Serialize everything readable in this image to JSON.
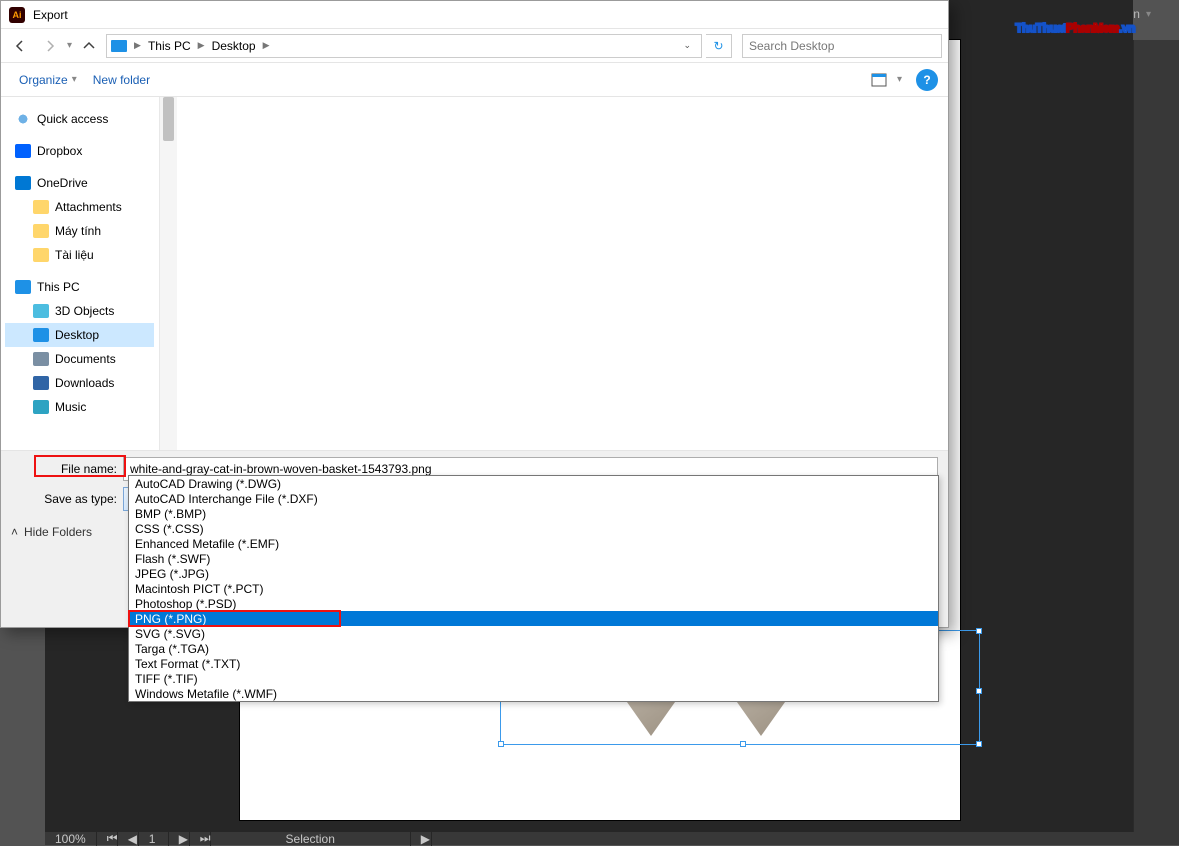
{
  "ai": {
    "menu_automation": "Automation",
    "status": {
      "zoom": "100%",
      "center": "Selection"
    }
  },
  "watermark": {
    "part1": "ThuThuat",
    "part2": "PhanMem",
    "part3": ".vn"
  },
  "dialog": {
    "title": "Export",
    "nav": {
      "pc": "This PC",
      "desktop": "Desktop"
    },
    "refresh_icon": "↻",
    "search_placeholder": "Search Desktop",
    "toolbar": {
      "organize": "Organize",
      "newfolder": "New folder"
    },
    "tree": {
      "quick": "Quick access",
      "dropbox": "Dropbox",
      "onedrive": "OneDrive",
      "attachments": "Attachments",
      "maytinh": "Máy tính",
      "tailieu": "Tài liệu",
      "thispc": "This PC",
      "objects3d": "3D Objects",
      "desktop": "Desktop",
      "documents": "Documents",
      "downloads": "Downloads",
      "music": "Music"
    },
    "fields": {
      "fname_label": "File name:",
      "fname_value": "white-and-gray-cat-in-brown-woven-basket-1543793.png",
      "type_label": "Save as type:",
      "type_value": "PNG (*.PNG)"
    },
    "hide_folders": "Hide Folders",
    "type_options": [
      "AutoCAD Drawing (*.DWG)",
      "AutoCAD Interchange File (*.DXF)",
      "BMP (*.BMP)",
      "CSS (*.CSS)",
      "Enhanced Metafile (*.EMF)",
      "Flash (*.SWF)",
      "JPEG (*.JPG)",
      "Macintosh PICT (*.PCT)",
      "Photoshop (*.PSD)",
      "PNG (*.PNG)",
      "SVG (*.SVG)",
      "Targa (*.TGA)",
      "Text Format (*.TXT)",
      "TIFF (*.TIF)",
      "Windows Metafile (*.WMF)"
    ],
    "selected_type_index": 9
  }
}
